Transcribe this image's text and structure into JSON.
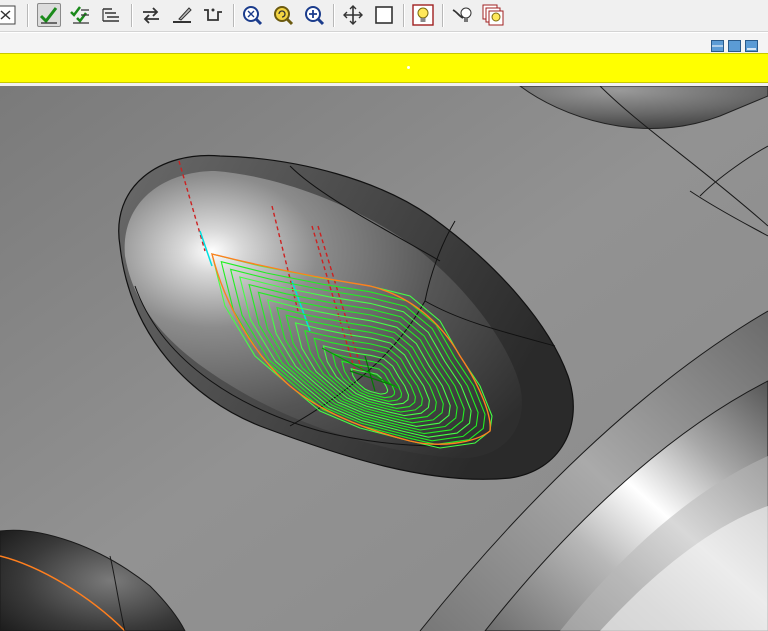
{
  "toolbar": {
    "buttons": [
      {
        "name": "close-window-button",
        "icon": "close-box-icon"
      },
      {
        "name": "accept-toolpath-button",
        "icon": "checkmark-pencil-icon",
        "pressed": true
      },
      {
        "name": "accept-multiple-button",
        "icon": "multi-checkmark-icon"
      },
      {
        "name": "layers-button",
        "icon": "stacked-layers-icon"
      },
      {
        "name": "swap-direction-button",
        "icon": "swap-arrows-icon"
      },
      {
        "name": "surface-edit-button",
        "icon": "pencil-surface-icon"
      },
      {
        "name": "pocket-profile-button",
        "icon": "pocket-profile-icon"
      },
      {
        "name": "zoom-fit-button",
        "icon": "zoom-fit-icon"
      },
      {
        "name": "zoom-previous-button",
        "icon": "zoom-previous-icon"
      },
      {
        "name": "zoom-in-button",
        "icon": "zoom-in-icon"
      },
      {
        "name": "pan-view-button",
        "icon": "move-cross-icon"
      },
      {
        "name": "box-view-button",
        "icon": "square-icon"
      },
      {
        "name": "light-button",
        "icon": "lightbulb-icon"
      },
      {
        "name": "light-direction-button",
        "icon": "light-probe-icon"
      },
      {
        "name": "multi-light-button",
        "icon": "multi-lightbulb-icon"
      }
    ]
  },
  "window_controls": [
    "tile-horizontal-icon",
    "tile-vertical-icon",
    "minimize-pane-icon"
  ],
  "colors": {
    "status_bar": "#ffff00",
    "toolpath": "#22ee22",
    "boundary": "#ff7f1e",
    "leadin": "#00e0e0",
    "plunge": "#cc2222"
  }
}
